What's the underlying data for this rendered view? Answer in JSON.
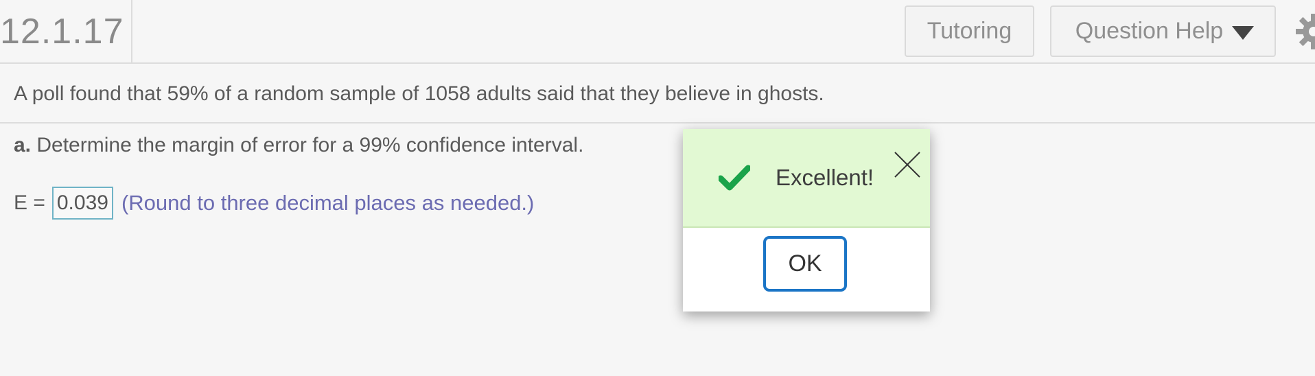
{
  "header": {
    "question_number": "12.1.17",
    "tutoring_label": "Tutoring",
    "question_help_label": "Question Help",
    "settings_icon": "gear-icon"
  },
  "question": {
    "statement": "A poll found that 59% of a random sample of 1058 adults said that they believe in ghosts.",
    "part_a_prefix": "a.",
    "part_a_text": " Determine the margin of error for a 99% confidence interval.",
    "answer_label": "E =",
    "answer_value": "0.039",
    "hint": "(Round to three decimal places as needed.)"
  },
  "dialog": {
    "message": "Excellent!",
    "ok_label": "OK",
    "status_icon": "checkmark-icon",
    "close_icon": "close-icon",
    "colors": {
      "header_bg": "#e2f9d3",
      "check": "#1aa34a",
      "ok_border": "#1b75c6"
    }
  }
}
